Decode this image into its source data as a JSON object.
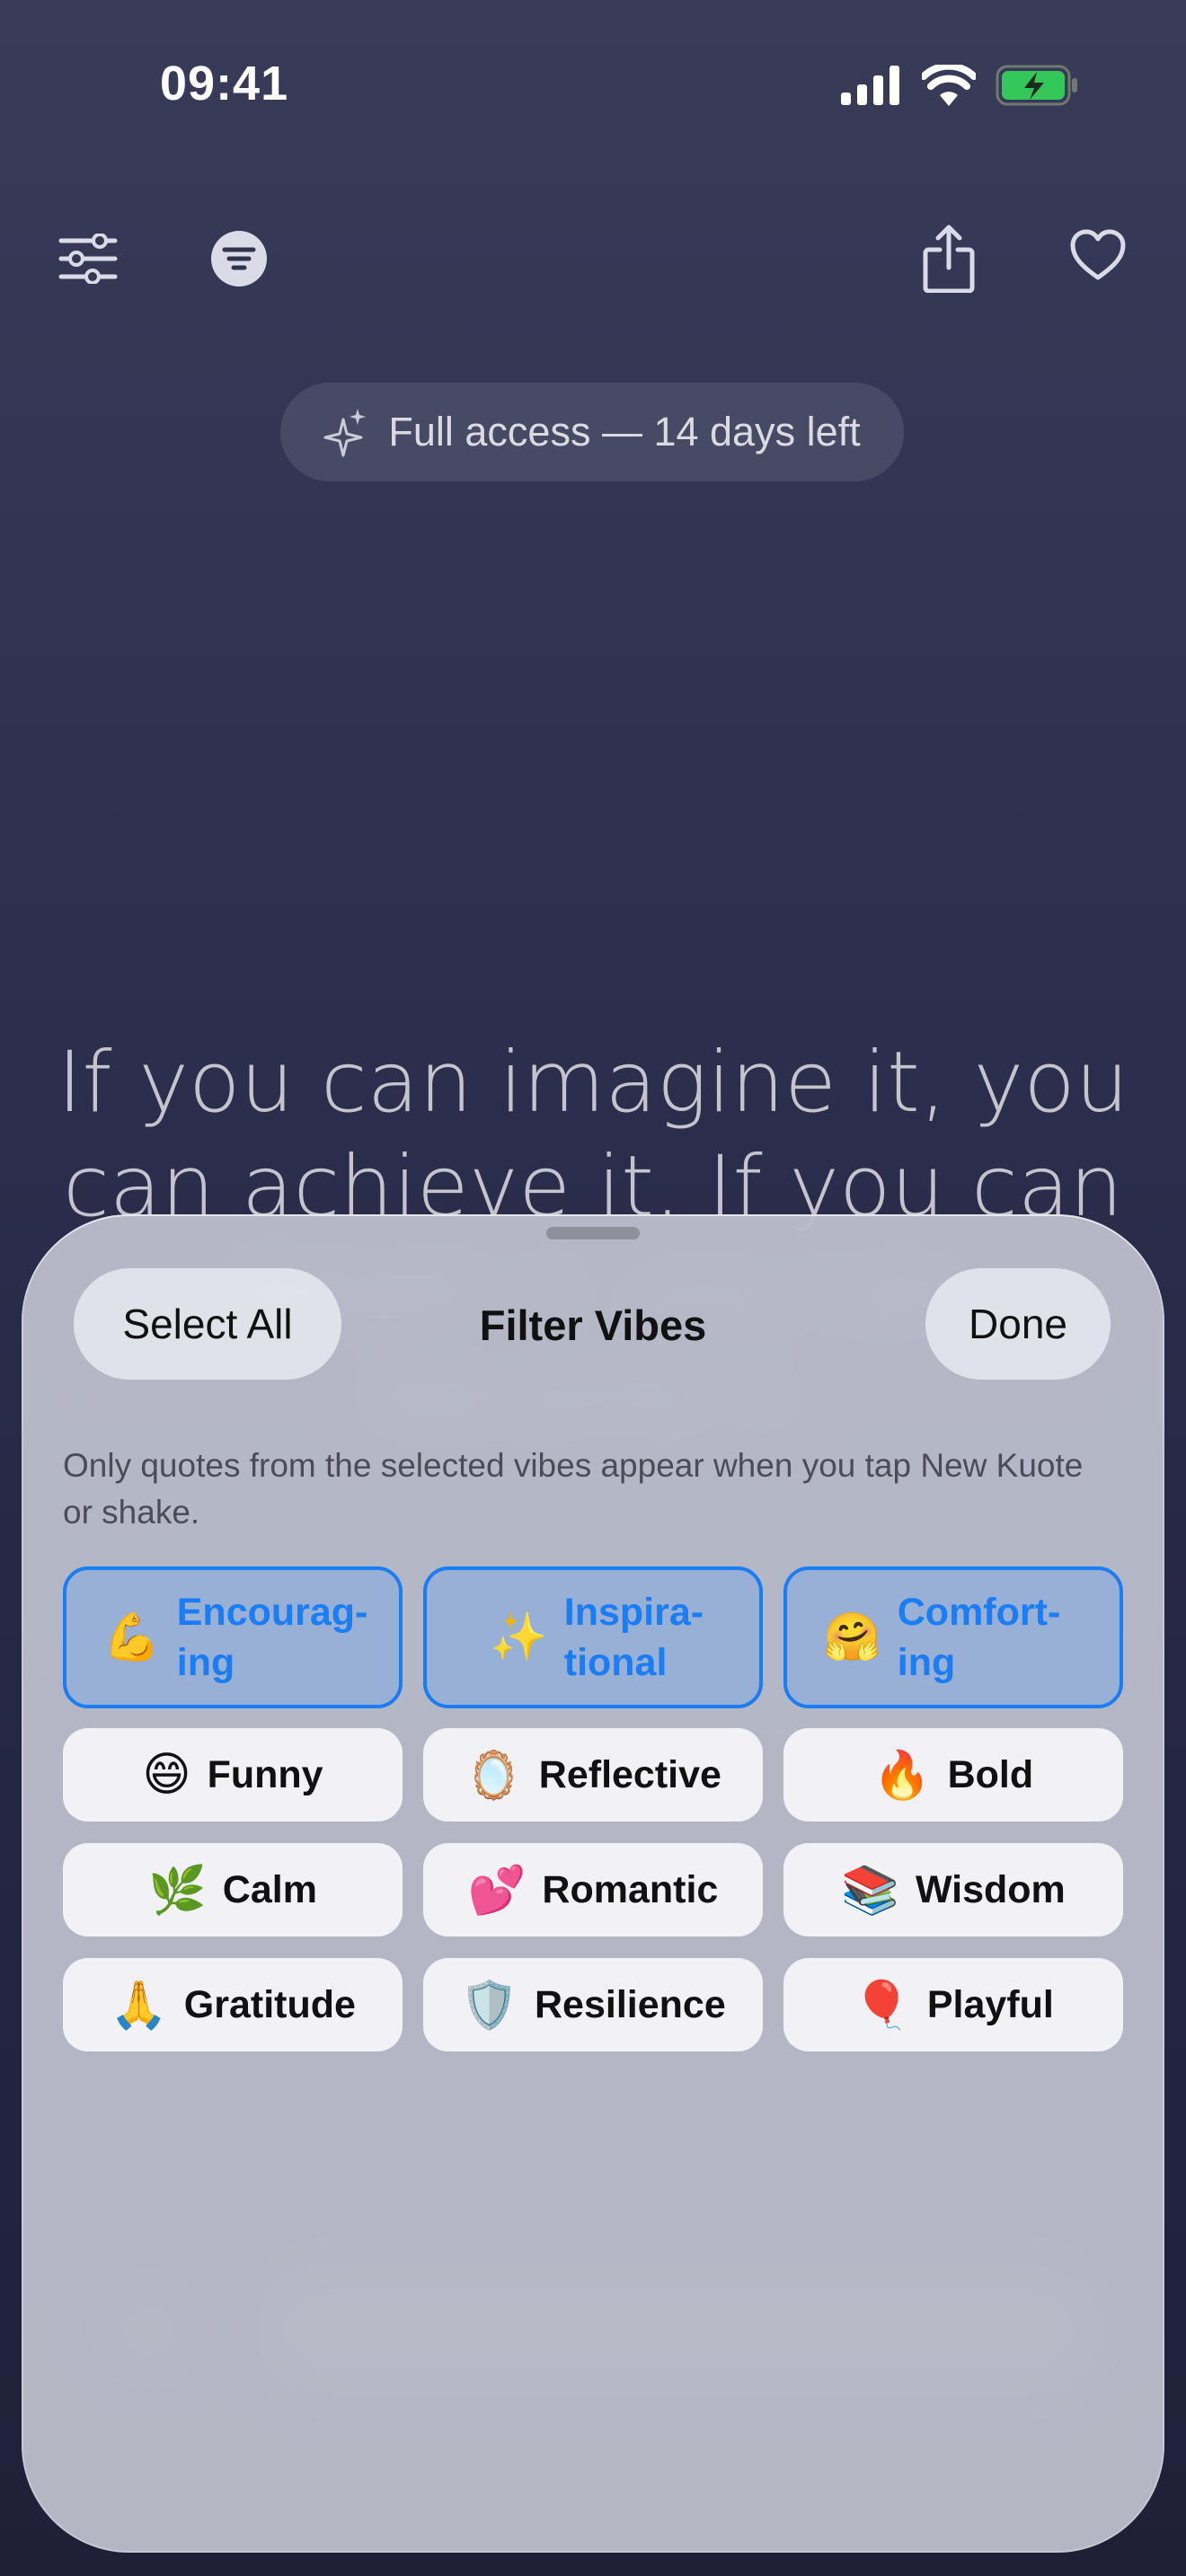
{
  "status_bar": {
    "time": "09:41"
  },
  "toolbar": {
    "icons": [
      "sliders-icon",
      "vibes-filter-icon",
      "share-icon",
      "heart-icon"
    ]
  },
  "trial": {
    "label": "Full access — 14 days left"
  },
  "quote": {
    "text": "If you can imagine it, you can achieve it. If you can dream it, you can become it."
  },
  "sheet": {
    "title": "Filter Vibes",
    "select_all": "Select All",
    "done": "Done",
    "description": "Only quotes from the selected vibes appear when you tap New Kuote or shake.",
    "vibes": [
      {
        "emoji": "💪",
        "label": "Encourag-ing",
        "line1": "Encourag-",
        "line2": "ing",
        "selected": true
      },
      {
        "emoji": "✨",
        "label": "Inspira-tional",
        "line1": "Inspira-",
        "line2": "tional",
        "selected": true
      },
      {
        "emoji": "🤗",
        "label": "Comfort-ing",
        "line1": "Comfort-",
        "line2": "ing",
        "selected": true
      },
      {
        "emoji": "😄",
        "label": "Funny",
        "selected": false
      },
      {
        "emoji": "🪞",
        "label": "Reflective",
        "selected": false
      },
      {
        "emoji": "🔥",
        "label": "Bold",
        "selected": false
      },
      {
        "emoji": "🌿",
        "label": "Calm",
        "selected": false
      },
      {
        "emoji": "💕",
        "label": "Romantic",
        "selected": false
      },
      {
        "emoji": "📚",
        "label": "Wisdom",
        "selected": false
      },
      {
        "emoji": "🙏",
        "label": "Gratitude",
        "selected": false
      },
      {
        "emoji": "🛡️",
        "label": "Resilience",
        "selected": false
      },
      {
        "emoji": "🎈",
        "label": "Playful",
        "selected": false
      }
    ]
  },
  "colors": {
    "accent": "#1a7df4",
    "selected_chip": "#98b0d6",
    "chip": "#f2f2f6"
  }
}
